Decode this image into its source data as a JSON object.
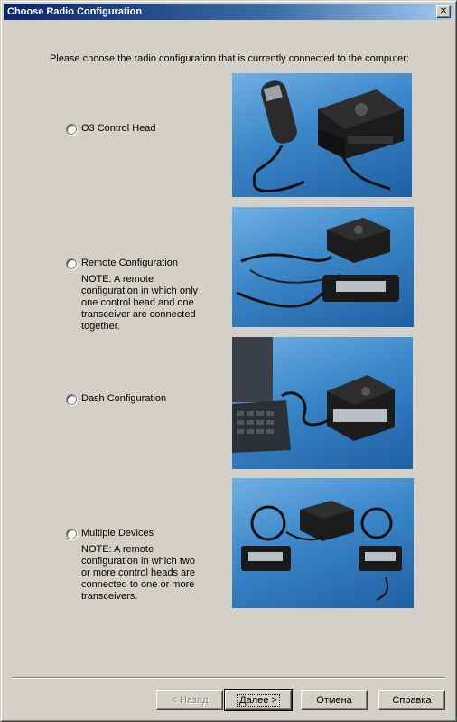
{
  "window": {
    "title": "Choose Radio Configuration",
    "close_glyph": "✕"
  },
  "instruction": "Please choose the radio configuration that is currently connected to the computer:",
  "options": [
    {
      "label": "O3 Control Head",
      "note": "",
      "selected": false
    },
    {
      "label": "Remote Configuration",
      "note": "NOTE: A remote configuration in which only one control head and one transceiver are connected together.",
      "selected": false
    },
    {
      "label": "Dash Configuration",
      "note": "",
      "selected": false
    },
    {
      "label": "Multiple Devices",
      "note": "NOTE: A remote configuration in which two or more control heads are connected to one or more transceivers.",
      "selected": false
    }
  ],
  "buttons": {
    "back": "< Назад",
    "next": "Далее >",
    "cancel": "Отмена",
    "help": "Справка"
  },
  "colors": {
    "title_bar": "#0a246a",
    "dialog_bg": "#d4d0c8",
    "photo_bg": "#3a86c8"
  }
}
